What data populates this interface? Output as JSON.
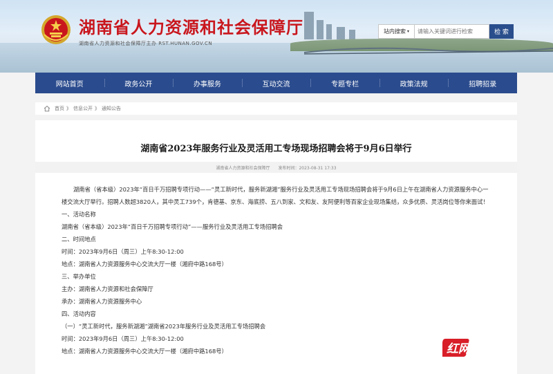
{
  "header": {
    "site_title": "湖南省人力资源和社会保障厅",
    "site_subtitle": "湖南省人力资源和社会保障厅主办  RST.HUNAN.GOV.CN",
    "search": {
      "scope_label": "站内搜索",
      "placeholder": "请输入关键词进行检索",
      "button_label": "检 索"
    }
  },
  "nav": {
    "items": [
      "网站首页",
      "政务公开",
      "办事服务",
      "互动交流",
      "专题专栏",
      "政策法规",
      "招聘招录"
    ]
  },
  "breadcrumb": {
    "items": [
      "首页",
      "信息公开",
      "通知公告"
    ],
    "separator": "》"
  },
  "article": {
    "title": "湖南省2023年服务行业及灵活用工专场现场招聘会将于9月6日举行",
    "source": "湖南省人力资源和社会保障厅",
    "publish_time": "发布时间：2023-08-31 17:33",
    "lead": "湖南省（省本级）2023年“百日千万招聘专项行动——“灵工新时代，服务新湖湘”服务行业及灵活用工专场现场招聘会将于9月6日上午在湖南省人力资源服务中心一楼交流大厅举行。招聘人数超3820人，其中灵工739个，肯德基、京东、海底捞、五八到家、文和友、友阿便利等百家企业现场集结，众多优质、灵活岗位等你来面试！",
    "lines": [
      "一、活动名称",
      "湖南省（省本级）2023年“百日千万招聘专项行动”——服务行业及灵活用工专场招聘会",
      "二、时间地点",
      "时间：2023年9月6日（周三）上午8:30-12:00",
      "地点：湖南省人力资源服务中心交流大厅一楼（湘府中路168号）",
      "三、举办单位",
      "主办：湖南省人力资源和社会保障厅",
      "承办：湖南省人力资源服务中心",
      "四、活动内容",
      "（一）“灵工新时代，服务新湖湘”湖南省2023年服务行业及灵活用工专场招聘会",
      "时间：2023年9月6日（周三）上午8:30-12:00",
      "地点：湖南省人力资源服务中心交流大厅一楼（湘府中路168号）"
    ]
  },
  "watermark": "红网时刻",
  "colors": {
    "nav_bg": "#2a4b8d",
    "title_red": "#c9161d",
    "search_btn": "#2a4e8c"
  }
}
